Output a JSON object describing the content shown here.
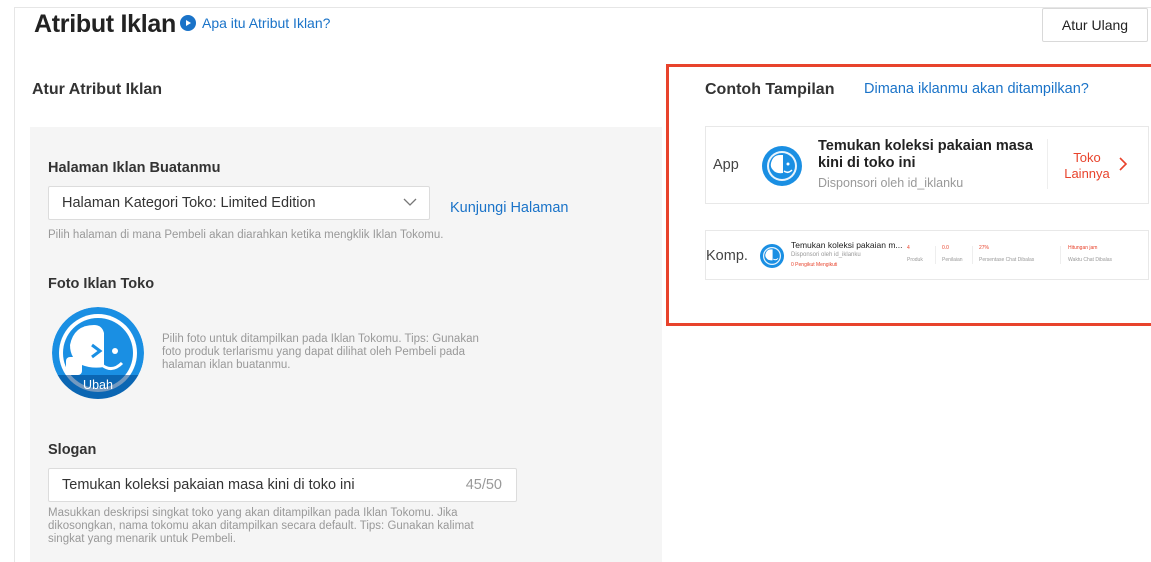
{
  "header": {
    "title": "Atribut Iklan",
    "help_link": "Apa itu Atribut Iklan?",
    "reset_button": "Atur Ulang"
  },
  "settings": {
    "section_title": "Atur Atribut Iklan",
    "ad_page": {
      "label": "Halaman Iklan Buatanmu",
      "selected_value": "Halaman Kategori Toko: Limited Edition",
      "visit_link": "Kunjungi Halaman",
      "help": "Pilih halaman di mana Pembeli akan diarahkan ketika mengklik Iklan Tokomu."
    },
    "photo": {
      "label": "Foto Iklan Toko",
      "change_label": "Ubah",
      "help": "Pilih foto untuk ditampilkan pada Iklan Tokomu. Tips: Gunakan foto produk terlarismu yang dapat dilihat oleh Pembeli pada halaman iklan buatanmu."
    },
    "slogan": {
      "label": "Slogan",
      "value": "Temukan koleksi pakaian masa kini di toko ini",
      "counter": "45/50",
      "help": "Masukkan deskripsi singkat toko yang akan ditampilkan pada Iklan Tokomu. Jika dikosongkan, nama tokomu akan ditampilkan secara default. Tips: Gunakan kalimat singkat yang menarik untuk Pembeli."
    }
  },
  "preview": {
    "title": "Contoh Tampilan",
    "where_link": "Dimana iklanmu akan ditampilkan?",
    "app": {
      "label": "App",
      "headline": "Temukan koleksi pakaian masa kini di toko ini",
      "sponsor": "Disponsori oleh id_iklanku",
      "more_link": "Toko Lainnya"
    },
    "komp": {
      "label": "Komp.",
      "headline": "Temukan koleksi pakaian m...",
      "sponsor": "Disponsori oleh id_iklanku",
      "followers": "0 Pengikut   Mengikuti",
      "stats": [
        {
          "value": "4",
          "label": "Produk"
        },
        {
          "value": "0.0",
          "label": "Penilaian"
        },
        {
          "value": "27%",
          "label": "Persentase Chat Dibalas"
        },
        {
          "value": "Hitungan jam",
          "label": "Waktu Chat Dibalas"
        }
      ]
    }
  },
  "colors": {
    "link": "#1a73c8",
    "highlight_frame": "#e8432c",
    "logo_blue": "#1a8fe3"
  },
  "icons": [
    "play-circle-icon",
    "chevron-down-icon",
    "chevron-right-icon",
    "shop-logo-icon"
  ]
}
